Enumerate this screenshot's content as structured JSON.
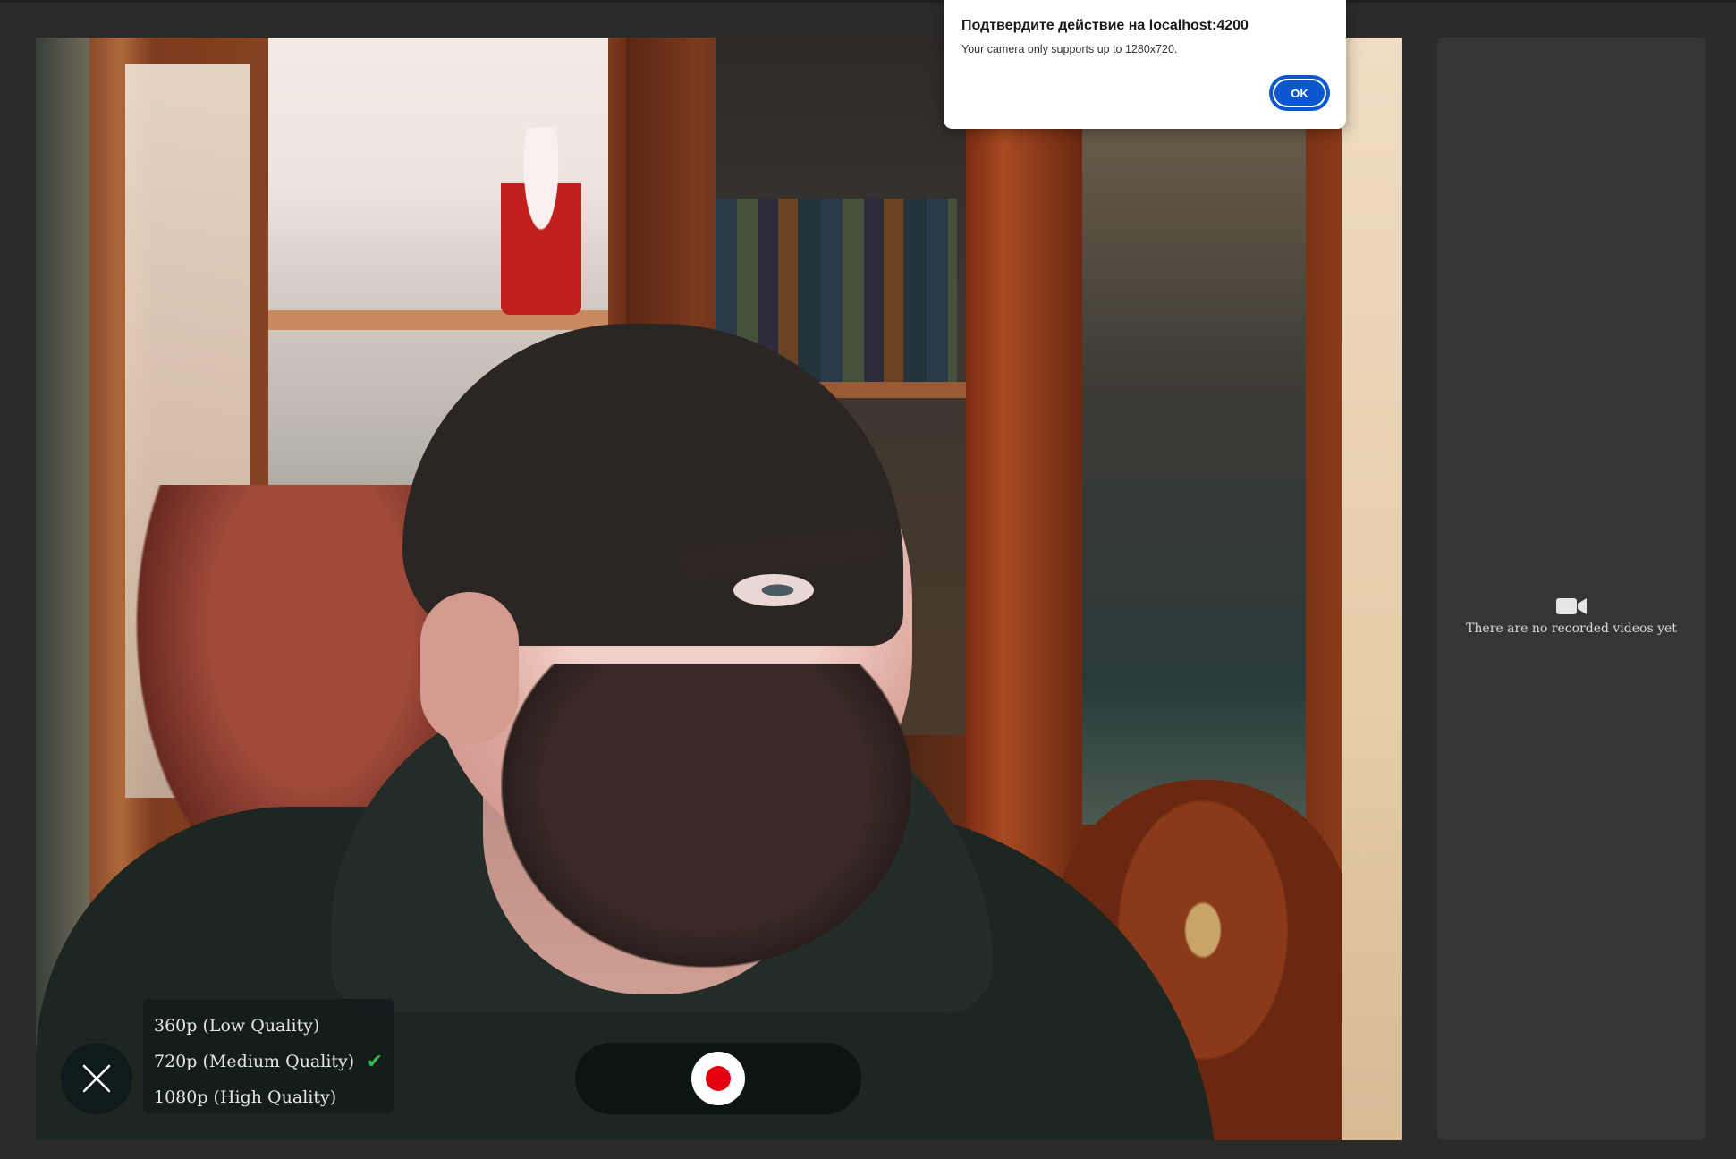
{
  "dialog": {
    "title": "Подтвердите действие на localhost:4200",
    "message": "Your camera only supports up to 1280x720.",
    "ok_label": "OK"
  },
  "camera": {
    "close_icon": "close-icon",
    "quality_options": [
      {
        "label": "360p (Low Quality)",
        "selected": false
      },
      {
        "label": "720p (Medium Quality)",
        "selected": true
      },
      {
        "label": "1080p (High Quality)",
        "selected": false
      }
    ],
    "selected_check": "✔",
    "record_icon": "record-icon",
    "colors": {
      "record": "#e3000f",
      "check": "#2fbf4b",
      "dialog_button": "#0b57d0"
    }
  },
  "recordings": {
    "empty_icon": "video-camera-icon",
    "empty_text": "There are no recorded videos yet"
  }
}
